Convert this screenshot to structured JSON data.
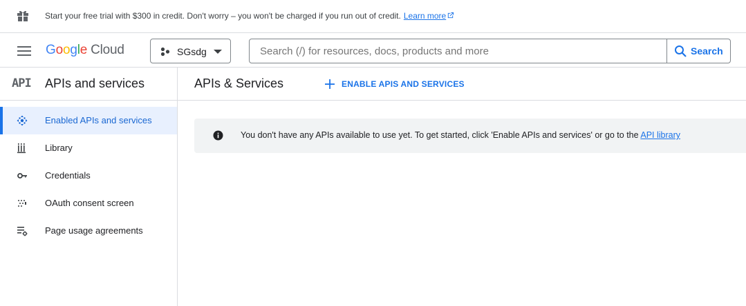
{
  "banner": {
    "message": "Start your free trial with $300 in credit. Don't worry – you won't be charged if you run out of credit.",
    "link_label": "Learn more",
    "icon": "gift-icon"
  },
  "header": {
    "logo_google": "Google",
    "logo_cloud": "Cloud",
    "project_name": "SGsdg",
    "search_placeholder": "Search (/) for resources, docs, products and more",
    "search_button": "Search"
  },
  "sidebar": {
    "badge": "API",
    "title": "APIs and services",
    "items": [
      {
        "label": "Enabled APIs and services",
        "icon": "enabled-apis-icon",
        "active": true
      },
      {
        "label": "Library",
        "icon": "library-icon",
        "active": false
      },
      {
        "label": "Credentials",
        "icon": "key-icon",
        "active": false
      },
      {
        "label": "OAuth consent screen",
        "icon": "oauth-icon",
        "active": false
      },
      {
        "label": "Page usage agreements",
        "icon": "settings-list-icon",
        "active": false
      }
    ]
  },
  "main": {
    "title": "APIs & Services",
    "enable_button": "ENABLE APIS AND SERVICES",
    "notice_text": "You don't have any APIs available to use yet. To get started, click 'Enable APIs and services' or go to the",
    "notice_link": "API library"
  },
  "colors": {
    "accent": "#1a73e8",
    "active_bg": "#e8f0fe",
    "notice_bg": "#f1f3f4",
    "border": "#dadce0"
  }
}
